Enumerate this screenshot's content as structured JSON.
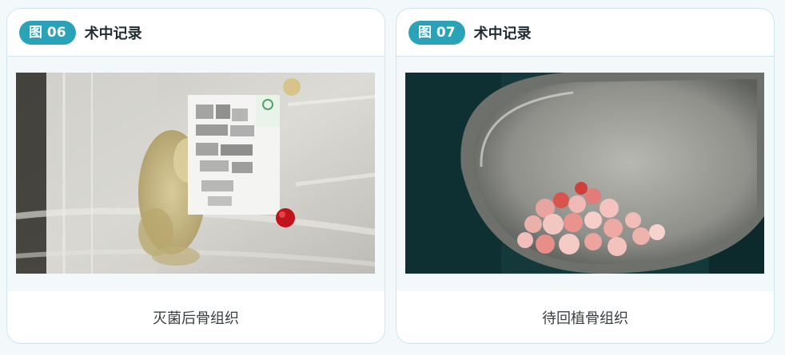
{
  "cards": [
    {
      "badge": "图 06",
      "title": "术中记录",
      "caption": "灭菌后骨组织"
    },
    {
      "badge": "图 07",
      "title": "术中记录",
      "caption": "待回植骨组织"
    }
  ],
  "colors": {
    "accent": "#2aa3b9",
    "border": "#cfe6ee",
    "background": "#f3f9fb"
  }
}
